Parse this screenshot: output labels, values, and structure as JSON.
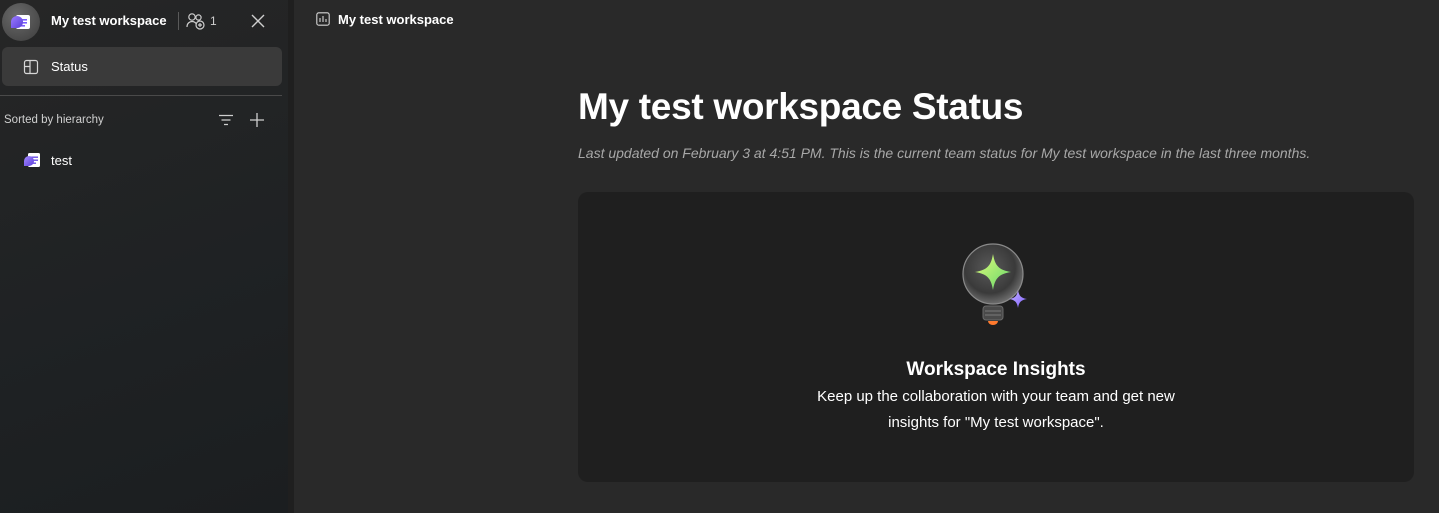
{
  "sidebar": {
    "workspace_title": "My test workspace",
    "members_count": "1",
    "nav": {
      "status_label": "Status"
    },
    "sort_label": "Sorted by hierarchy",
    "tree": [
      {
        "label": "test"
      }
    ]
  },
  "main": {
    "breadcrumb": "My test workspace",
    "title": "My test workspace Status",
    "subtitle": "Last updated on February 3 at 4:51 PM. This is the current team status for My test workspace in the last three months.",
    "insights": {
      "title": "Workspace Insights",
      "body": "Keep up the collaboration with your team and get new insights for \"My test workspace\"."
    }
  },
  "colors": {
    "background": "#292929",
    "sidebar": "#1f2224",
    "selected_item": "#3a3a3a",
    "card": "#1f1f1f",
    "accent": "#7b5cff",
    "muted_text": "#a8a8a8"
  },
  "icons": {
    "workspace_avatar": "workspace-page-icon",
    "members": "people-add-icon",
    "close": "close-icon",
    "status": "board-icon",
    "filter": "filter-icon",
    "add": "plus-icon",
    "tree_item": "loop-page-icon",
    "breadcrumb": "chart-icon",
    "insights": "lightbulb-sparkle-icon"
  }
}
